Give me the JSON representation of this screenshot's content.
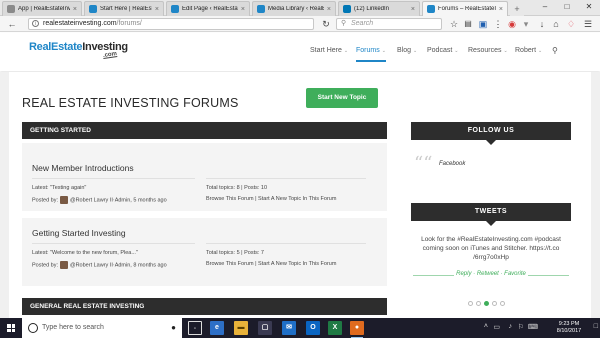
{
  "browser": {
    "tabs": [
      {
        "title": "App | RealEstateInvesting.com",
        "favicon_color": "#8a8a8a"
      },
      {
        "title": "Start Here | RealEstateInves...",
        "favicon_color": "#1f86c7"
      },
      {
        "title": "Edit Page ‹ RealEstateInvesti...",
        "favicon_color": "#1f86c7"
      },
      {
        "title": "Media Library ‹ RealEstateIn...",
        "favicon_color": "#1f86c7"
      },
      {
        "title": "(12) LinkedIn",
        "favicon_color": "#0077b5"
      },
      {
        "title": "Forums – RealEstateInvesting...",
        "favicon_color": "#1f86c7"
      }
    ],
    "tab_close": "×",
    "new_tab": "+",
    "window_controls": {
      "minimize": "–",
      "maximize": "□",
      "close": "✕"
    },
    "url_domain": "realestateinvesting.com",
    "url_path": "/forums/",
    "search_placeholder": "Search",
    "icons": [
      "back-icon",
      "info-icon",
      "reload-icon",
      "search-icon",
      "star-icon",
      "reading-list-icon",
      "download-icon",
      "pocket-icon",
      "menu-icon"
    ]
  },
  "site": {
    "logo_main": "RealEstate",
    "logo_bold": "Investing",
    "logo_sub": ".com",
    "brand_color": "#1f86c7",
    "nav": [
      {
        "label": "Start Here",
        "has_caret": true
      },
      {
        "label": "Forums",
        "has_caret": true,
        "active": true
      },
      {
        "label": "Blog",
        "has_caret": true
      },
      {
        "label": "Podcast",
        "has_caret": true
      },
      {
        "label": "Resources",
        "has_caret": true
      },
      {
        "label": "Robert",
        "has_caret": true
      }
    ],
    "caret": "⌄"
  },
  "page": {
    "title": "REAL ESTATE INVESTING FORUMS",
    "new_topic_label": "Start New Topic",
    "button_color": "#3fae5b",
    "categories": [
      {
        "label": "GETTING STARTED"
      },
      {
        "label": "GENERAL REAL ESTATE INVESTING"
      }
    ],
    "forums": [
      {
        "title": "New Member Introductions",
        "latest": "Latest: \"Testing again\"",
        "posted_by_label": "Posted by:",
        "posted_by": "@Robert Lawry II·Admin, 5 months ago",
        "stats": "Total topics: 8 | Posts: 10",
        "links": "Browse This Forum | Start A New Topic In This Forum"
      },
      {
        "title": "Getting Started Investing",
        "latest": "Latest: \"Welcome to the new forum, Plea...\"",
        "posted_by_label": "Posted by:",
        "posted_by": "@Robert Lawry II·Admin, 8 months ago",
        "stats": "Total topics: 5 | Posts: 7",
        "links": "Browse This Forum | Start A New Topic In This Forum"
      }
    ]
  },
  "sidebar": {
    "follow_title": "FOLLOW US",
    "quote_mark": "““",
    "facebook_label": "Facebook",
    "tweets_title": "TWEETS",
    "tweet_text": "Look for the #RealEstateInvesting.com #podcast coming soon on iTunes and Stitcher. https://t.co /6rrg7o0xHp",
    "tweet_actions": "Reply ·  Retweet ·  Favorite",
    "carousel_active_index": 2,
    "carousel_count": 5
  },
  "taskbar": {
    "search_placeholder": "Type here to search",
    "mic": "🎤",
    "apps": [
      {
        "name": "task-view",
        "color": "#1c1c2a",
        "glyph": "▫"
      },
      {
        "name": "edge",
        "color": "#2d6fc7",
        "glyph": "e"
      },
      {
        "name": "file-explorer",
        "color": "#e8b23a",
        "glyph": "▬"
      },
      {
        "name": "store",
        "color": "#3a3a52",
        "glyph": "▢"
      },
      {
        "name": "mail",
        "color": "#1f6fc7",
        "glyph": "✉"
      },
      {
        "name": "outlook",
        "color": "#0a65c2",
        "glyph": "O"
      },
      {
        "name": "excel",
        "color": "#1f7a44",
        "glyph": "X"
      },
      {
        "name": "firefox",
        "color": "#e06b1f",
        "glyph": "●",
        "running": true
      },
      {
        "name": "chrome",
        "color": "#3a3a52",
        "glyph": "◉"
      }
    ],
    "tray_symbols": [
      "˄",
      "▭",
      "♪",
      "⚑"
    ],
    "time": "9:23 PM",
    "date": "8/10/2017"
  }
}
